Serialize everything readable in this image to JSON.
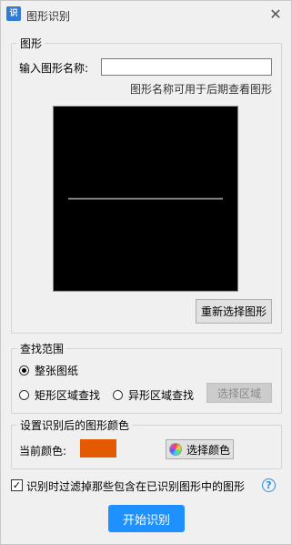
{
  "window": {
    "icon": "shape-recognize-app-icon",
    "icon_text": "识",
    "title": "图形识别",
    "close_glyph": "✕"
  },
  "shape_group": {
    "legend": "图形",
    "name_label": "输入图形名称:",
    "name_value": "",
    "hint": "图形名称可用于后期查看图形",
    "reselect_button": "重新选择图形"
  },
  "search_group": {
    "legend": "查找范围",
    "options": [
      {
        "label": "整张图纸",
        "checked": true
      },
      {
        "label": "矩形区域查找",
        "checked": false
      },
      {
        "label": "异形区域查找",
        "checked": false
      }
    ],
    "select_area_button": "选择区域"
  },
  "color_group": {
    "legend": "设置识别后的图形颜色",
    "current_label": "当前颜色:",
    "current_color": "#e35a00",
    "choose_button": "选择颜色"
  },
  "filter": {
    "checked": true,
    "check_glyph": "✓",
    "label": "识别时过滤掉那些包含在已识别图形中的图形",
    "help_glyph": "?"
  },
  "start_button": "开始识别"
}
